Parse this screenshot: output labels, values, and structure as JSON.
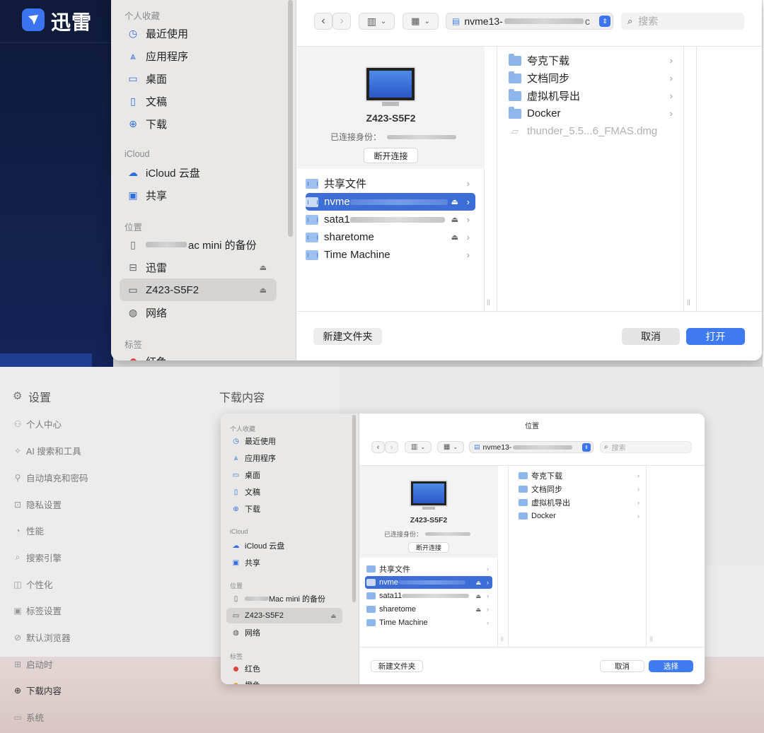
{
  "app": {
    "name": "迅雷"
  },
  "top_dialog": {
    "sidebar": {
      "favorites_heading": "个人收藏",
      "favorites": [
        {
          "label": "最近使用",
          "icon": "clock-icon"
        },
        {
          "label": "应用程序",
          "icon": "apps-icon"
        },
        {
          "label": "桌面",
          "icon": "desktop-icon"
        },
        {
          "label": "文稿",
          "icon": "document-icon"
        },
        {
          "label": "下载",
          "icon": "download-icon"
        }
      ],
      "icloud_heading": "iCloud",
      "icloud": [
        {
          "label": "iCloud 云盘",
          "icon": "cloud-icon"
        },
        {
          "label": "共享",
          "icon": "shared-folder-icon"
        }
      ],
      "locations_heading": "位置",
      "locations": [
        {
          "label": "ac mini 的备份",
          "icon": "file-icon"
        },
        {
          "label": "迅雷",
          "icon": "drive-icon"
        },
        {
          "label": "Z423-S5F2",
          "icon": "computer-icon",
          "selected": true
        },
        {
          "label": "网络",
          "icon": "globe-icon"
        }
      ],
      "tags_heading": "标签",
      "tags": [
        {
          "label": "红色",
          "color": "#e0443e"
        }
      ]
    },
    "toolbar": {
      "path": "nvme13-",
      "path_suffix": "c",
      "search_placeholder": "搜索"
    },
    "server": {
      "name": "Z423-S5F2",
      "connected_as": "已连接身份：",
      "disconnect": "断开连接"
    },
    "shares": [
      {
        "label": "共享文件",
        "eject": false
      },
      {
        "label": "nvme",
        "eject": true,
        "selected": true
      },
      {
        "label": "sata1",
        "eject": true
      },
      {
        "label": "sharetome",
        "eject": true
      },
      {
        "label": "Time Machine",
        "eject": false
      }
    ],
    "contents": [
      {
        "label": "夸克下载",
        "type": "folder"
      },
      {
        "label": "文档同步",
        "type": "folder"
      },
      {
        "label": "虚拟机导出",
        "type": "folder"
      },
      {
        "label": "Docker",
        "type": "folder"
      },
      {
        "label": "thunder_5.5...6_FMAS.dmg",
        "type": "file"
      }
    ],
    "new_folder": "新建文件夹",
    "cancel": "取消",
    "open": "打开"
  },
  "settings": {
    "title": "设置",
    "section_title": "下载内容",
    "items": [
      {
        "label": "个人中心",
        "icon": "user-icon"
      },
      {
        "label": "AI 搜索和工具",
        "icon": "sparkle-icon"
      },
      {
        "label": "自动填充和密码",
        "icon": "key-icon"
      },
      {
        "label": "隐私设置",
        "icon": "lock-icon"
      },
      {
        "label": "性能",
        "icon": "gauge-icon"
      },
      {
        "label": "搜索引擎",
        "icon": "search-icon"
      },
      {
        "label": "个性化",
        "icon": "palette-icon"
      },
      {
        "label": "标签设置",
        "icon": "tab-icon"
      },
      {
        "label": "默认浏览器",
        "icon": "compass-icon"
      },
      {
        "label": "启动时",
        "icon": "power-icon"
      },
      {
        "label": "下载内容",
        "icon": "download-icon",
        "active": true
      },
      {
        "label": "系统",
        "icon": "monitor-icon"
      }
    ]
  },
  "bottom_dialog": {
    "title": "位置",
    "sidebar": {
      "favorites_heading": "个人收藏",
      "favorites": [
        "最近使用",
        "应用程序",
        "桌面",
        "文稿",
        "下载"
      ],
      "icloud_heading": "iCloud",
      "icloud": [
        "iCloud 云盘",
        "共享"
      ],
      "locations_heading": "位置",
      "locations": [
        "Mac mini 的备份",
        "Z423-S5F2",
        "网络"
      ],
      "tags_heading": "标签",
      "tags": [
        "红色",
        "橙色"
      ]
    },
    "toolbar": {
      "path": "nvme13-",
      "search_placeholder": "搜索"
    },
    "server": {
      "name": "Z423-S5F2",
      "connected_as": "已连接身份：",
      "disconnect": "断开连接"
    },
    "shares": [
      "共享文件",
      "nvme",
      "sata11",
      "sharetome",
      "Time Machine"
    ],
    "contents": [
      "夸克下载",
      "文档同步",
      "虚拟机导出",
      "Docker"
    ],
    "new_folder": "新建文件夹",
    "cancel": "取消",
    "choose": "选择"
  }
}
